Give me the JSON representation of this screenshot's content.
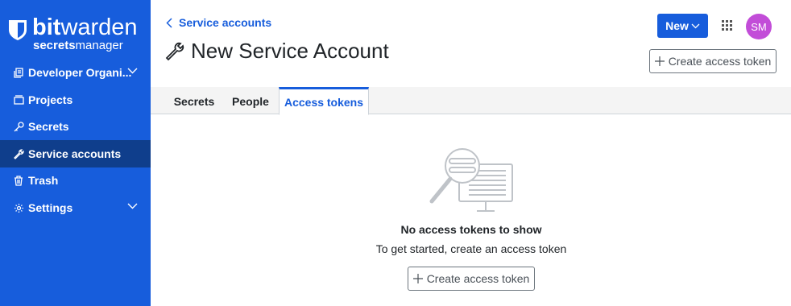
{
  "brand": {
    "name_bold": "bit",
    "name_light": "warden",
    "sub_bold": "secrets",
    "sub_light": "manager"
  },
  "sidebar": {
    "items": [
      {
        "label": "Developer Organi...",
        "icon": "organization-icon",
        "expandable": true
      },
      {
        "label": "Projects",
        "icon": "projects-icon",
        "expandable": false
      },
      {
        "label": "Secrets",
        "icon": "key-icon",
        "expandable": false
      },
      {
        "label": "Service accounts",
        "icon": "wrench-icon",
        "expandable": false,
        "active": true
      },
      {
        "label": "Trash",
        "icon": "trash-icon",
        "expandable": false
      },
      {
        "label": "Settings",
        "icon": "gear-icon",
        "expandable": true
      }
    ]
  },
  "header": {
    "back_label": "Service accounts",
    "title": "New Service Account",
    "new_button": "New",
    "avatar_initials": "SM",
    "avatar_color": "#c24dd8",
    "create_token_button": "Create access token"
  },
  "tabs": [
    {
      "label": "Secrets"
    },
    {
      "label": "People"
    },
    {
      "label": "Access tokens",
      "active": true
    }
  ],
  "empty_state": {
    "title": "No access tokens to show",
    "subtitle": "To get started, create an access token",
    "button": "Create access token",
    "illustration": "search-monitor-illustration"
  },
  "colors": {
    "primary": "#175ddc",
    "sidebar_active": "#0f3e8c"
  }
}
